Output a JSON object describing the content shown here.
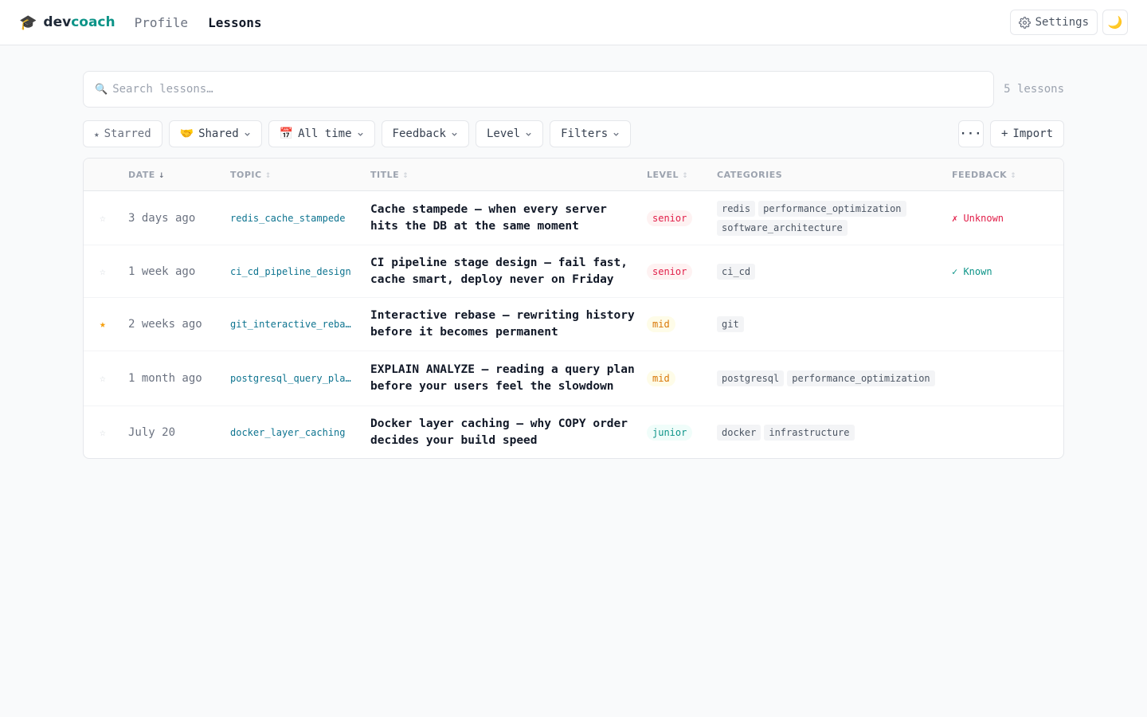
{
  "header": {
    "brand_icon": "graduation-cap-icon",
    "brand_dev": "dev",
    "brand_coach": "coach",
    "nav": [
      {
        "label": "Profile",
        "active": false
      },
      {
        "label": "Lessons",
        "active": true
      }
    ],
    "settings_label": "Settings",
    "theme_icon": "moon-icon"
  },
  "search": {
    "placeholder": "Search lessons…",
    "value": "",
    "count": "5 lessons"
  },
  "filters": {
    "starred": "Starred",
    "shared": "Shared",
    "time": "All time",
    "feedback": "Feedback",
    "level": "Level",
    "more": "Filters",
    "menu": "···",
    "import": "Import"
  },
  "table": {
    "headers": {
      "date": "DATE",
      "topic": "TOPIC",
      "title": "TITLE",
      "level": "LEVEL",
      "categories": "CATEGORIES",
      "feedback": "FEEDBACK"
    },
    "rows": [
      {
        "starred": false,
        "date": "3 days ago",
        "topic": "redis_cache_stampede",
        "title": "Cache stampede — when every server hits the DB at the same moment",
        "level": "senior",
        "categories": [
          "redis",
          "performance_optimization",
          "software_architecture"
        ],
        "feedback": "✗ Unknown",
        "feedback_type": "unknown"
      },
      {
        "starred": false,
        "date": "1 week ago",
        "topic": "ci_cd_pipeline_design",
        "title": "CI pipeline stage design — fail fast, cache smart, deploy never on Friday",
        "level": "senior",
        "categories": [
          "ci_cd"
        ],
        "feedback": "✓ Known",
        "feedback_type": "known"
      },
      {
        "starred": true,
        "date": "2 weeks ago",
        "topic": "git_interactive_rebase",
        "title": "Interactive rebase — rewriting history before it becomes permanent",
        "level": "mid",
        "categories": [
          "git"
        ],
        "feedback": "",
        "feedback_type": ""
      },
      {
        "starred": false,
        "date": "1 month ago",
        "topic": "postgresql_query_planner",
        "title": "EXPLAIN ANALYZE — reading a query plan before your users feel the slowdown",
        "level": "mid",
        "categories": [
          "postgresql",
          "performance_optimization"
        ],
        "feedback": "",
        "feedback_type": ""
      },
      {
        "starred": false,
        "date": "July 20",
        "topic": "docker_layer_caching",
        "title": "Docker layer caching — why COPY order decides your build speed",
        "level": "junior",
        "categories": [
          "docker",
          "infrastructure"
        ],
        "feedback": "",
        "feedback_type": ""
      }
    ]
  }
}
